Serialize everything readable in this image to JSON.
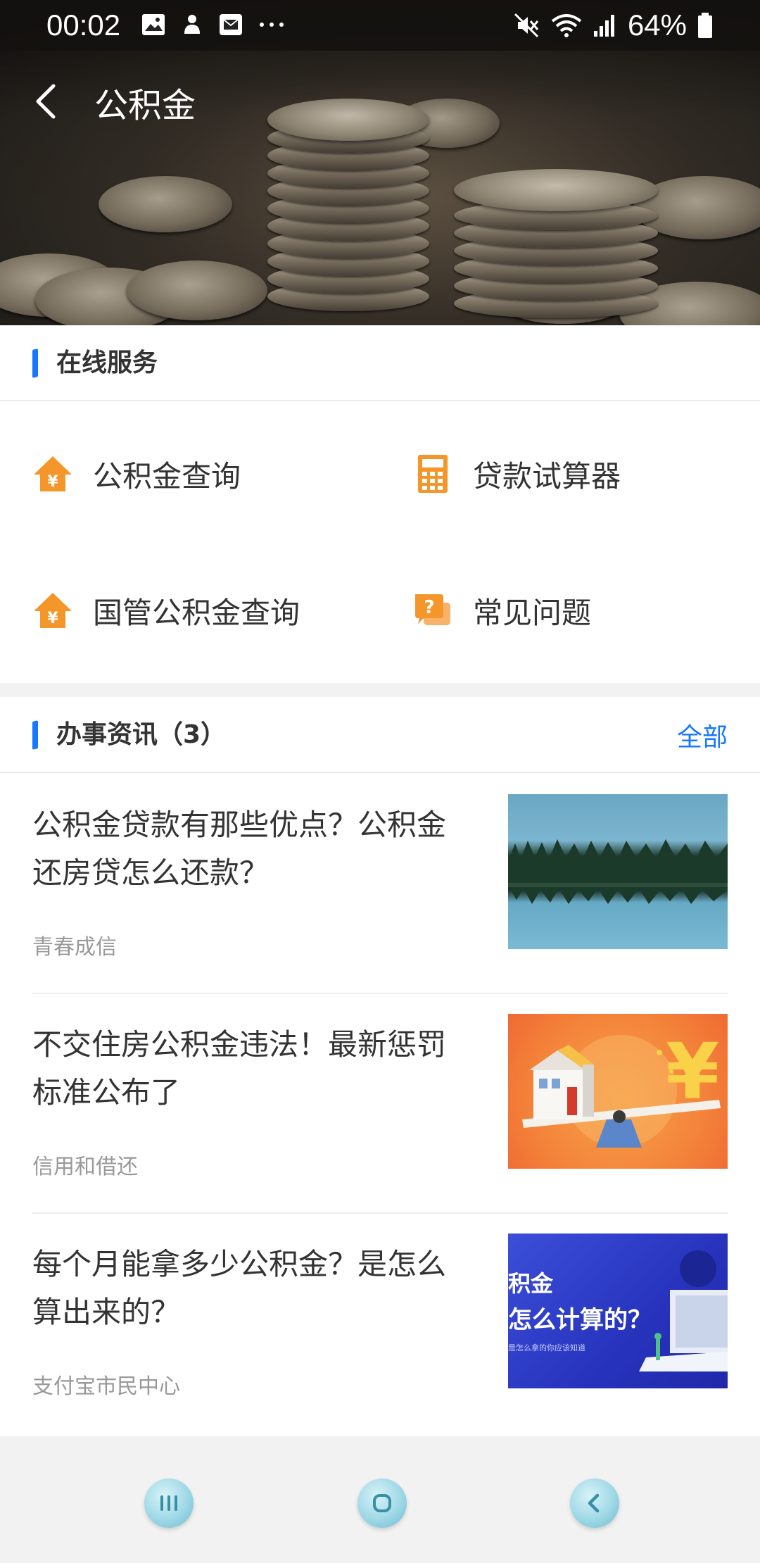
{
  "status_bar": {
    "time": "00:02",
    "battery": "64%",
    "icons_left": [
      "image-icon",
      "notification-icon",
      "mail-icon",
      "more-dots-icon"
    ],
    "icons_right": [
      "mute-icon",
      "wifi-icon",
      "signal-icon",
      "battery-icon"
    ]
  },
  "header": {
    "title": "公积金"
  },
  "services": {
    "section_title": "在线服务",
    "items": [
      {
        "label": "公积金查询",
        "icon": "house-yuan-icon"
      },
      {
        "label": "贷款试算器",
        "icon": "calculator-icon"
      },
      {
        "label": "国管公积金查询",
        "icon": "house-yuan-icon"
      },
      {
        "label": "常见问题",
        "icon": "question-chat-icon"
      }
    ]
  },
  "news": {
    "section_title": "办事资讯（3）",
    "more_label": "全部",
    "items": [
      {
        "title": "公积金贷款有那些优点？公积金还房贷怎么还款？",
        "source": "青春成信",
        "thumb": "lake-forest-image"
      },
      {
        "title": "不交住房公积金违法！最新惩罚标准公布了",
        "source": "信用和借还",
        "thumb": "house-yuan-seesaw-image"
      },
      {
        "title": "每个月能拿多少公积金？是怎么算出来的？",
        "source": "支付宝市民中心",
        "thumb": "blue-calc-banner-image",
        "thumb_text_1": "积金",
        "thumb_text_2": "怎么计算的？",
        "thumb_text_3": "是怎么拿的你应该知道"
      }
    ]
  },
  "colors": {
    "accent": "#1677ff",
    "service_icon": "#f5962a"
  }
}
